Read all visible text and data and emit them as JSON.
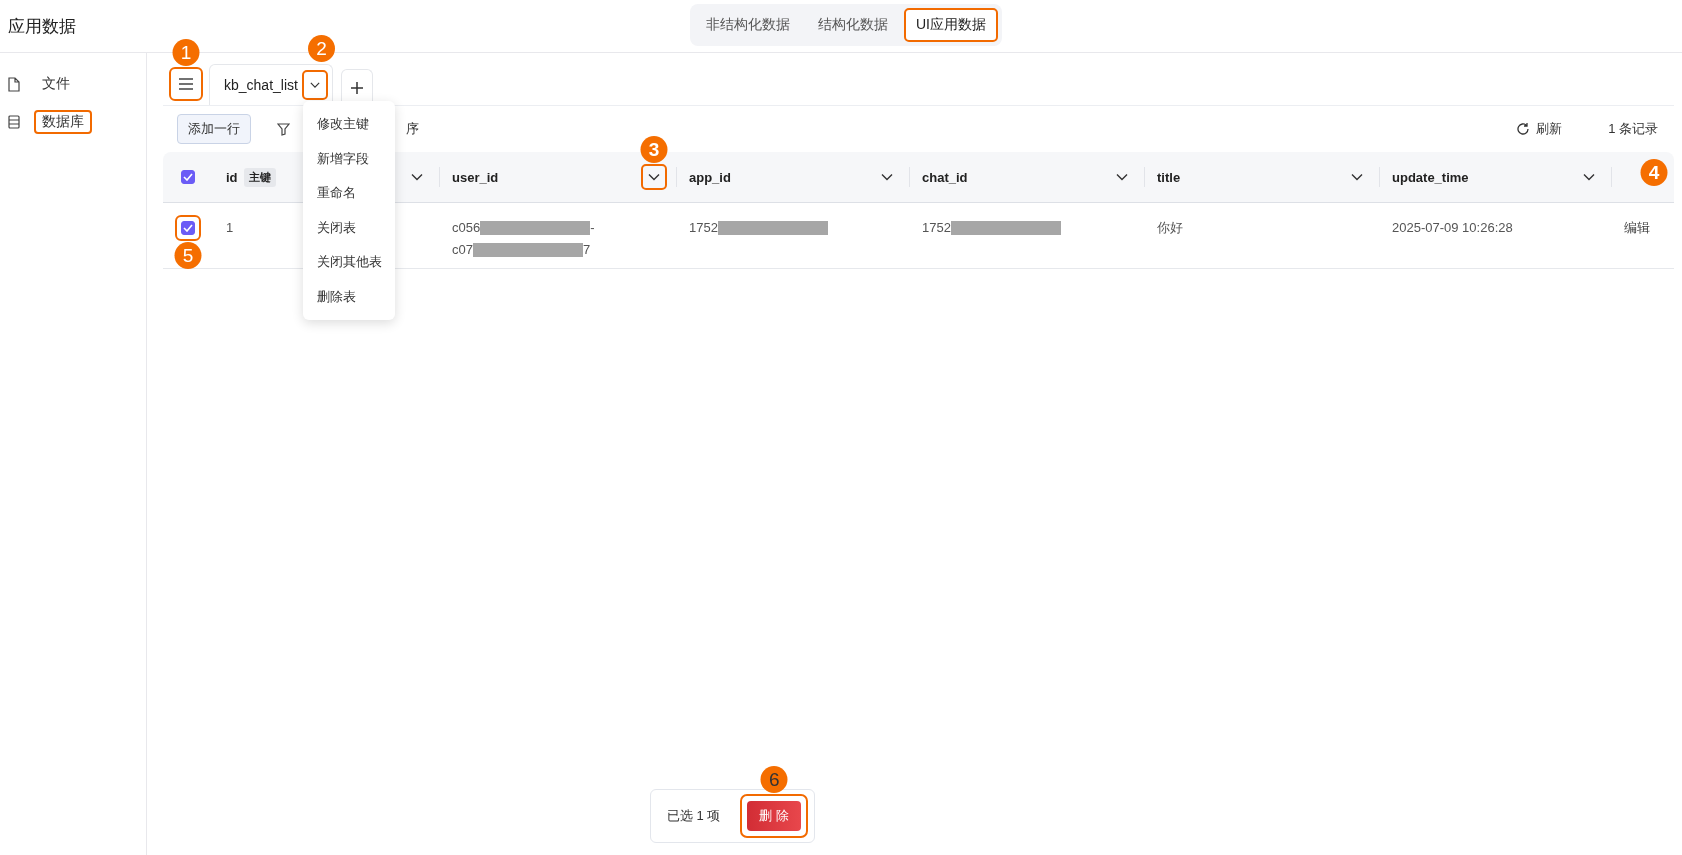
{
  "app_title": "应用数据",
  "source_tabs": [
    {
      "label": "非结构化数据",
      "selected": false,
      "highlighted": false
    },
    {
      "label": "结构化数据",
      "selected": false,
      "highlighted": false
    },
    {
      "label": "UI应用数据",
      "selected": true,
      "highlighted": true
    }
  ],
  "sidebar": {
    "items": [
      {
        "label": "文件",
        "kind": "file",
        "highlighted": false
      },
      {
        "label": "数据库",
        "kind": "database",
        "highlighted": true
      }
    ]
  },
  "table_tabs": {
    "menu_button": {
      "highlighted": true,
      "callout": "1"
    },
    "tabs": [
      {
        "label": "kb_chat_list",
        "dropdown_highlighted": true,
        "callout": "2"
      }
    ],
    "tab_menu": [
      {
        "label": "修改主键"
      },
      {
        "label": "新增字段"
      },
      {
        "label": "重命名"
      },
      {
        "label": "关闭表"
      },
      {
        "label": "关闭其他表"
      },
      {
        "label": "删除表"
      }
    ]
  },
  "toolbar": {
    "add_row": "添加一行",
    "sort_fragment": "序",
    "refresh": "刷新",
    "record_count": "1 条记录"
  },
  "table": {
    "select_all_checked": true,
    "columns": [
      {
        "name": "id",
        "tag": "主键",
        "caret_highlighted": false
      },
      {
        "name": "user_id",
        "caret_highlighted": true,
        "callout": "3"
      },
      {
        "name": "app_id",
        "caret_highlighted": false
      },
      {
        "name": "chat_id",
        "caret_highlighted": false
      },
      {
        "name": "title",
        "caret_highlighted": false
      },
      {
        "name": "update_time",
        "caret_highlighted": false
      }
    ],
    "action_column": {
      "callout": "4"
    },
    "rows": [
      {
        "checked": true,
        "checkbox_highlighted": true,
        "callout": "5",
        "cells": [
          {
            "kind": "text",
            "text": "1"
          },
          {
            "kind": "masked",
            "lines": [
              [
                "c056",
                "-"
              ],
              [
                "c07",
                "7"
              ]
            ]
          },
          {
            "kind": "masked",
            "lines": [
              [
                "1752"
              ]
            ]
          },
          {
            "kind": "masked",
            "lines": [
              [
                "1752"
              ]
            ]
          },
          {
            "kind": "text",
            "text": "你好"
          },
          {
            "kind": "text",
            "text": "2025-07-09 10:26:28"
          }
        ],
        "action": "编辑"
      }
    ]
  },
  "selection_bar": {
    "summary": "已选 1 项",
    "delete_label": "删 除",
    "delete_highlighted": true,
    "callout": "6"
  }
}
